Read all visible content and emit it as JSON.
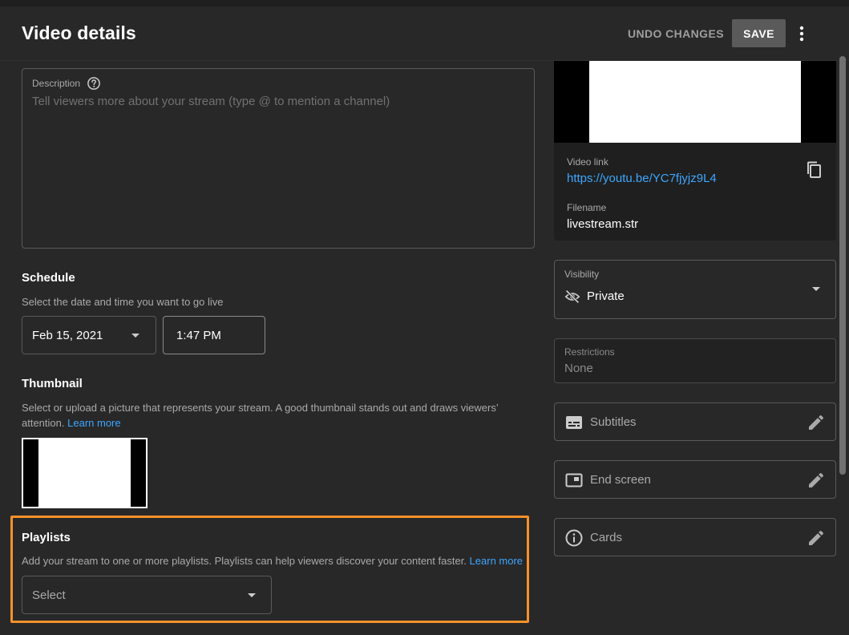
{
  "header": {
    "title": "Video details",
    "undo_label": "UNDO CHANGES",
    "save_label": "SAVE"
  },
  "description": {
    "label": "Description",
    "placeholder": "Tell viewers more about your stream (type @ to mention a channel)"
  },
  "schedule": {
    "title": "Schedule",
    "subtitle": "Select the date and time you want to go live",
    "date": "Feb 15, 2021",
    "time": "1:47 PM"
  },
  "thumbnail": {
    "title": "Thumbnail",
    "desc_line1": "Select or upload a picture that represents your stream. A good thumbnail stands out and draws viewers’",
    "desc_line2": "attention.",
    "learn_more": "Learn more"
  },
  "playlists": {
    "title": "Playlists",
    "desc": "Add your stream to one or more playlists. Playlists can help viewers discover your content faster.",
    "learn_more": "Learn more",
    "select_value": "Select"
  },
  "video_info": {
    "link_label": "Video link",
    "link": "https://youtu.be/YC7fjyjz9L4",
    "filename_label": "Filename",
    "filename": "livestream.str"
  },
  "visibility": {
    "label": "Visibility",
    "value": "Private"
  },
  "restrictions": {
    "label": "Restrictions",
    "value": "None"
  },
  "subtitles": {
    "label": "Subtitles"
  },
  "end_screen": {
    "label": "End screen"
  },
  "cards": {
    "label": "Cards"
  },
  "colors": {
    "background": "#282828",
    "accent_link": "#3ea6ff",
    "highlight": "#f7912a",
    "save_button": "#5a5a5a"
  },
  "icons": {
    "help": "help-circle-icon",
    "more": "more-vert-icon",
    "copy": "copy-icon",
    "visibility": "visibility-off-icon",
    "subtitles": "subtitles-icon",
    "end_screen": "end-screen-icon",
    "cards": "info-icon",
    "edit": "pencil-icon"
  }
}
